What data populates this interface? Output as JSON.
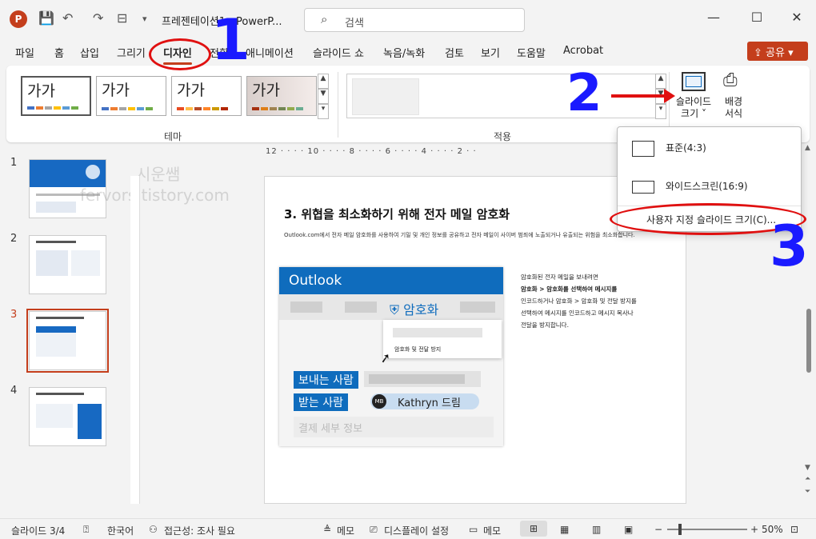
{
  "app": {
    "logo_letter": "P",
    "doc_title": "프레젠테이션1 - PowerP...",
    "search_placeholder": "검색",
    "win_min": "—",
    "win_max": "☐",
    "win_close": "✕"
  },
  "tabs": [
    "파일",
    "홈",
    "삽입",
    "그리기",
    "디자인",
    "전환",
    "애니메이션",
    "슬라이드 쇼",
    "녹음/녹화",
    "검토",
    "보기",
    "도움말",
    "Acrobat"
  ],
  "active_tab": "디자인",
  "share_label": "공유",
  "ribbon": {
    "theme_label": "테마",
    "variant_label": "적용",
    "theme_thumb_text": "가가",
    "slide_size_label_1": "슬라이드",
    "slide_size_label_2": "크기 ˅",
    "bg_format_label_1": "배경",
    "bg_format_label_2": "서식"
  },
  "slides": [
    {
      "num": "1"
    },
    {
      "num": "2"
    },
    {
      "num": "3"
    },
    {
      "num": "4"
    }
  ],
  "current_slide": "3",
  "ruler_text": "12 · · · · 10 · · · · 8 · · · · 6 · · · · 4 · · · · 2 · ·",
  "slide": {
    "heading": "3. 위협을 최소화하기 위해 전자 메일 암호화",
    "para": "Outlook.com에서 전자 메일 암호화를 사용하여 기밀 및 개인 정보를 공유하고 전자 메일이 사이버 범죄에 노출되거나 유출되는 위험을 최소화합니다.",
    "outlook_title": "Outlook",
    "encrypt_label": "암호화",
    "dropdown_item": "암호화 및 전달 방지",
    "sender_label": "보내는 사람",
    "recipient_label": "받는 사람",
    "avatar_initials": "MB",
    "recipient_name": "Kathryn 드림",
    "billing_placeholder": "결제 세부 정보",
    "side_text_1": "암호화된 전자 메일을 보내려면",
    "side_text_2": "암호화 > 암호화를 선택하여 메시지를",
    "side_text_3": "인코드하거나 암호화 > 암호화 및 전달 방지를",
    "side_text_4": "선택하여 메시지를 인코드하고 메시지 복사나",
    "side_text_5": "전달을 방지합니다."
  },
  "size_menu": {
    "standard": "표준(4:3)",
    "widescreen": "와이드스크린(16:9)",
    "custom": "사용자 지정 슬라이드 크기(C)..."
  },
  "watermark": {
    "line1": "시운쌤",
    "line2": "fervors.tistory.com"
  },
  "annotations": {
    "n1": "1",
    "n2": "2",
    "n3": "3"
  },
  "status": {
    "slide_pos": "슬라이드 3/4",
    "language": "한국어",
    "accessibility": "접근성: 조사 필요",
    "notes": "메모",
    "display": "디스플레이 설정",
    "comments": "메모",
    "zoom": "50%"
  },
  "colors": {
    "accent": "#c43e1c",
    "outlook_blue": "#0f6cbd",
    "annot_blue": "#1a1aff",
    "annot_red": "#e01010"
  }
}
